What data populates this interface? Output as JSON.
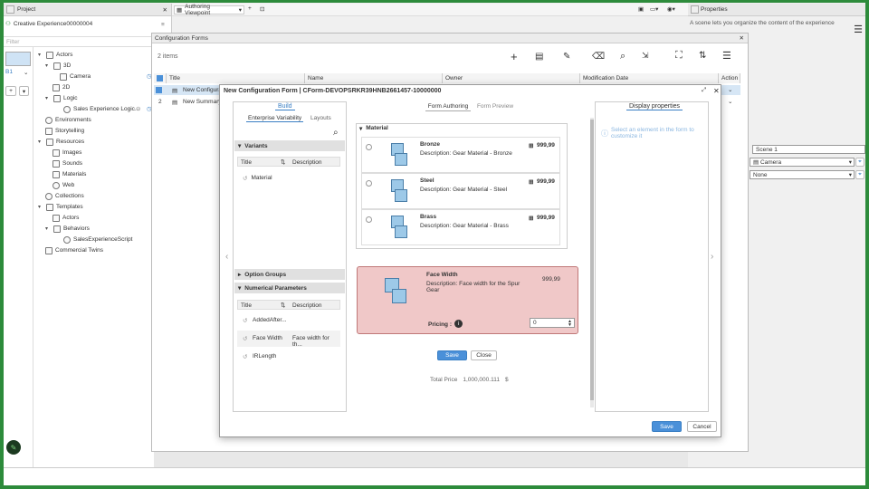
{
  "project": {
    "title": "Project",
    "experience": "Creative Experience00000004",
    "filter_placeholder": "Filter",
    "thumb_label": "B1",
    "tree": [
      {
        "label": "Actors",
        "icon": "folder-icon"
      },
      {
        "label": "3D",
        "icon": "folder-icon"
      },
      {
        "label": "Camera",
        "icon": "camera-icon"
      },
      {
        "label": "2D",
        "icon": "folder-icon"
      },
      {
        "label": "Logic",
        "icon": "folder-icon"
      },
      {
        "label": "Sales Experience Logic...",
        "icon": "script-icon"
      },
      {
        "label": "Environments",
        "icon": "globe-icon"
      },
      {
        "label": "Storytelling",
        "icon": "story-icon"
      },
      {
        "label": "Resources",
        "icon": "folder-icon"
      },
      {
        "label": "Images",
        "icon": "image-icon"
      },
      {
        "label": "Sounds",
        "icon": "sound-icon"
      },
      {
        "label": "Materials",
        "icon": "material-icon"
      },
      {
        "label": "Web",
        "icon": "web-icon"
      },
      {
        "label": "Collections",
        "icon": "collection-icon"
      },
      {
        "label": "Templates",
        "icon": "folder-icon"
      },
      {
        "label": "Actors",
        "icon": "folder-icon"
      },
      {
        "label": "Behaviors",
        "icon": "folder-icon"
      },
      {
        "label": "SalesExperienceScript",
        "icon": "script-icon"
      },
      {
        "label": "Commercial Twins",
        "icon": "twin-icon"
      }
    ]
  },
  "toolbar": {
    "viewpoint": "Authoring Viewpoint"
  },
  "properties": {
    "title": "Properties",
    "description": "A scene lets you organize the content of the experience",
    "scene": "Scene 1",
    "camera": "Camera",
    "none": "None"
  },
  "config_forms": {
    "title": "Configuration Forms",
    "count": "2 items",
    "columns": [
      "Title",
      "Name",
      "Owner",
      "Modification Date",
      "Action"
    ],
    "rows": [
      {
        "num": "",
        "title": "New Configura"
      },
      {
        "num": "2",
        "title": "New Summary"
      }
    ]
  },
  "dialog": {
    "title": "New Configuration Form | CForm-DEVOPSRKR39HNB2661457-10000000",
    "build_tab": "Build",
    "subtab_variability": "Enterprise Variability",
    "subtab_layouts": "Layouts",
    "variants_label": "Variants",
    "col_title": "Title",
    "col_description": "Description",
    "variant_row": "Material",
    "option_groups": "Option Groups",
    "numerical_params": "Numerical Parameters",
    "num_rows": [
      {
        "title": "AddedAfter...",
        "desc": ""
      },
      {
        "title": "Face Width",
        "desc": "Face width for th..."
      },
      {
        "title": "IRLength",
        "desc": ""
      }
    ],
    "form_authoring": "Form Authoring",
    "form_preview": "Form Preview",
    "material_section": "Material",
    "materials": [
      {
        "name": "Bronze",
        "desc": "Description: Gear Material - Bronze",
        "price": "999,99"
      },
      {
        "name": "Steel",
        "desc": "Description: Gear Material - Steel",
        "price": "999,99"
      },
      {
        "name": "Brass",
        "desc": "Description: Gear Material - Brass",
        "price": "999,99"
      }
    ],
    "face_width": {
      "name": "Face Width",
      "desc": "Description: Face width for the Spur Gear",
      "price": "999,99",
      "pricing_label": "Pricing :",
      "pricing_value": "0"
    },
    "inner_save": "Save",
    "inner_close": "Close",
    "total_price_label": "Total Price",
    "total_price_value": "1,000,000.111",
    "total_price_unit": "$",
    "display_properties": "Display properties",
    "display_hint": "Select an element in the form to customize it",
    "save": "Save",
    "cancel": "Cancel"
  },
  "colors": {
    "frame": "#2d8b3b",
    "accent": "#4a90d9",
    "face_width_bg": "#f0c8c8",
    "face_width_border": "#c07878"
  }
}
